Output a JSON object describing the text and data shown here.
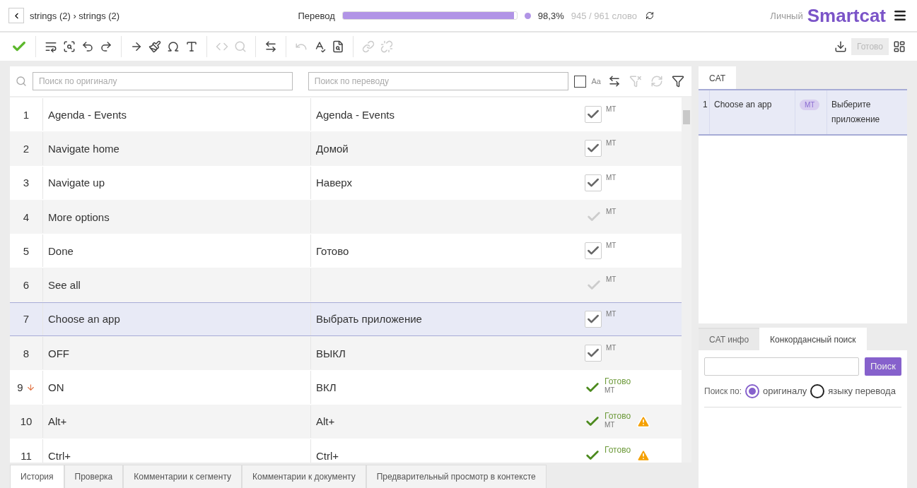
{
  "header": {
    "breadcrumb": "strings (2) › strings (2)",
    "progress_label": "Перевод",
    "progress": {
      "level": 0.983
    },
    "percent": "98,3%",
    "words": "945 / 961 слово",
    "account": "Личный",
    "logo": "Smartcat"
  },
  "toolbar": {
    "done_button": {
      "label": "Готово",
      "disabled": true
    }
  },
  "filters": {
    "source_placeholder": "Поиск по оригиналу",
    "target_placeholder": "Поиск по переводу",
    "match_case": {
      "label": "Aa",
      "checked": false
    }
  },
  "segments": [
    {
      "number": "1",
      "source": "Agenda - Events",
      "target": "Agenda - Events",
      "kind": "confirmed",
      "status_label": "МТ",
      "warning": false,
      "sorted": false,
      "selected": false
    },
    {
      "number": "2",
      "source": "Navigate home",
      "target": "Домой",
      "kind": "confirmed",
      "status_label": "МТ",
      "warning": false,
      "sorted": false,
      "selected": false
    },
    {
      "number": "3",
      "source": "Navigate up",
      "target": "Наверх",
      "kind": "confirmed",
      "status_label": "МТ",
      "warning": false,
      "sorted": false,
      "selected": false
    },
    {
      "number": "4",
      "source": "More options",
      "kind": "empty",
      "status_label": "МТ",
      "warning": false,
      "sorted": false,
      "selected": false
    },
    {
      "number": "5",
      "source": "Done",
      "target": "Готово",
      "kind": "confirmed",
      "status_label": "МТ",
      "warning": false,
      "sorted": false,
      "selected": false
    },
    {
      "number": "6",
      "source": "See all",
      "kind": "empty",
      "status_label": "МТ",
      "warning": false,
      "sorted": false,
      "selected": false
    },
    {
      "number": "7",
      "source": "Choose an app",
      "target": "Выбрать приложение",
      "kind": "confirmed",
      "status_label": "МТ",
      "warning": false,
      "sorted": false,
      "selected": true
    },
    {
      "number": "8",
      "source": "OFF",
      "target": "ВЫКЛ",
      "kind": "confirmed",
      "status_label": "МТ",
      "warning": false,
      "sorted": false,
      "selected": false
    },
    {
      "number": "9",
      "source": "ON",
      "target": "ВКЛ",
      "kind": "done",
      "status_text": "Готово",
      "status_label": "МТ",
      "warning": false,
      "sorted": true,
      "selected": false
    },
    {
      "number": "10",
      "source": "Alt+",
      "target": "Alt+",
      "kind": "done",
      "status_text": "Готово",
      "status_label": "МТ",
      "warning": true,
      "sorted": false,
      "selected": false
    },
    {
      "number": "11",
      "source": "Ctrl+",
      "target": "Ctrl+",
      "kind": "done",
      "status_text": "Готово",
      "warning": true,
      "sorted": false,
      "selected": false
    }
  ],
  "bottom_tabs": [
    {
      "label": "История",
      "selected": true
    },
    {
      "label": "Проверка",
      "selected": false
    },
    {
      "label": "Комментарии к сегменту",
      "selected": false
    },
    {
      "label": "Комментарии к документу",
      "selected": false
    },
    {
      "label": "Предварительный просмотр в контексте",
      "selected": false
    }
  ],
  "cat_panel": {
    "tabs": [
      {
        "label": "CAT",
        "selected": true
      }
    ],
    "matches": [
      {
        "number": "1",
        "source": "Choose an app",
        "badge": "МТ",
        "target": "Выберите приложение"
      }
    ]
  },
  "lower_panel": {
    "tabs": [
      {
        "label": "CAT инфо",
        "selected": false
      },
      {
        "label": "Конкордансный поиск",
        "selected": true
      }
    ],
    "search_button": "Поиск",
    "search_by": "Поиск по:",
    "options": [
      {
        "label": "оригиналу",
        "selected": true
      },
      {
        "label": "языку перевода",
        "selected": false
      }
    ]
  }
}
